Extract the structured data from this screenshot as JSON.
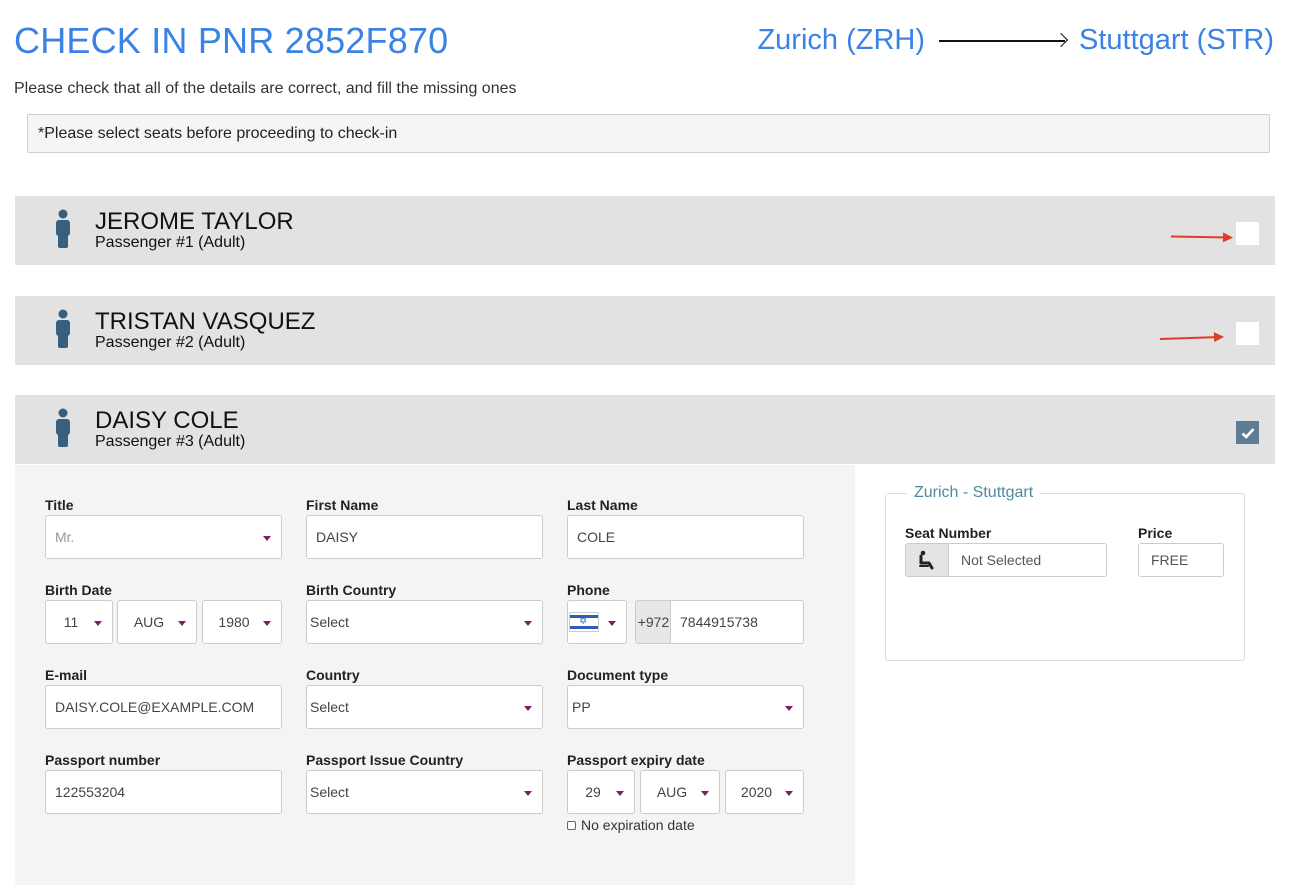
{
  "header": {
    "title": "CHECK IN PNR 2852F870",
    "origin": "Zurich (ZRH)",
    "destination": "Stuttgart (STR)",
    "subtitle": "Please check that all of the details are correct, and fill the missing ones",
    "notice": "*Please select seats before proceeding to check-in"
  },
  "passengers": [
    {
      "name": "JEROME TAYLOR",
      "type": "Passenger #1 (Adult)",
      "checked": false
    },
    {
      "name": "TRISTAN VASQUEZ",
      "type": "Passenger #2 (Adult)",
      "checked": false
    },
    {
      "name": "DAISY COLE",
      "type": "Passenger #3 (Adult)",
      "checked": true
    }
  ],
  "form": {
    "title_label": "Title",
    "title_value": "Mr.",
    "first_name_label": "First Name",
    "first_name_value": "DAISY",
    "last_name_label": "Last Name",
    "last_name_value": "COLE",
    "birth_date_label": "Birth Date",
    "birth_day": "11",
    "birth_month": "AUG",
    "birth_year": "1980",
    "birth_country_label": "Birth Country",
    "birth_country_value": "Select",
    "phone_label": "Phone",
    "phone_code": "+972",
    "phone_number": "7844915738",
    "email_label": "E-mail",
    "email_value": "DAISY.COLE@EXAMPLE.COM",
    "country_label": "Country",
    "country_value": "Select",
    "document_type_label": "Document type",
    "document_type_value": "PP",
    "passport_number_label": "Passport number",
    "passport_number_value": "122553204",
    "passport_issue_country_label": "Passport Issue Country",
    "passport_issue_country_value": "Select",
    "passport_expiry_label": "Passport expiry date",
    "expiry_day": "29",
    "expiry_month": "AUG",
    "expiry_year": "2020",
    "no_expiration_label": "No expiration date"
  },
  "segment": {
    "title": "Zurich - Stuttgart",
    "seat_label": "Seat Number",
    "seat_value": "Not Selected",
    "price_label": "Price",
    "price_value": "FREE"
  },
  "colors": {
    "accent": "#3b82e6",
    "bar": "#e2e2e2",
    "checked": "#5c7d94",
    "caret": "#7b1f6a",
    "annotation_arrow": "#e23c26"
  }
}
